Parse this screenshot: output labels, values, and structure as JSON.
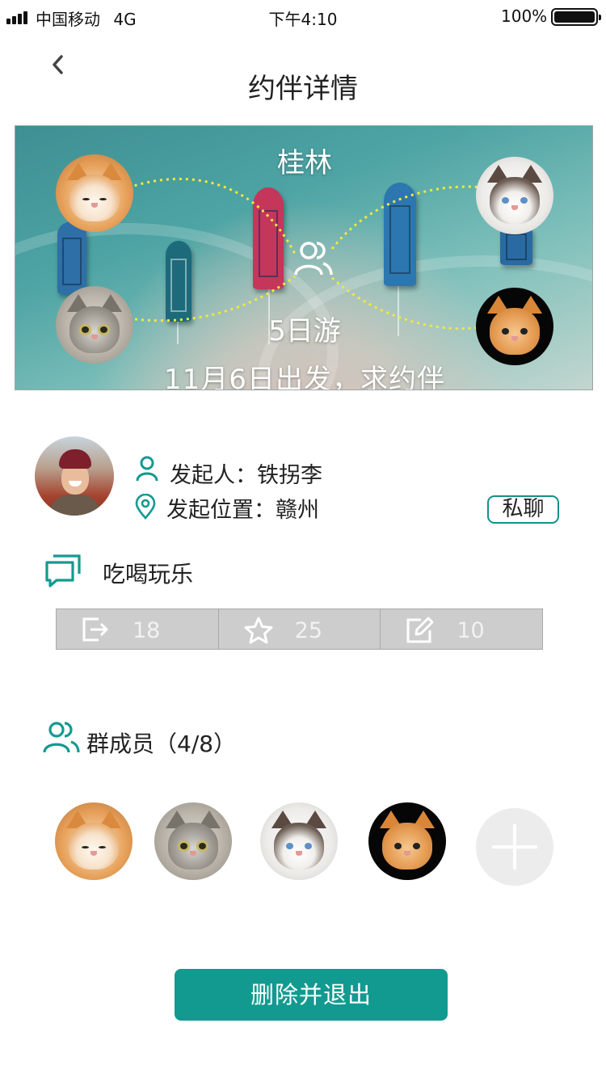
{
  "status_bar": {
    "carrier": "中国移动",
    "network": "4G",
    "time": "下午4:10",
    "battery": "100%"
  },
  "header": {
    "title": "约伴详情",
    "back_icon": "chevron-left-icon"
  },
  "banner": {
    "city": "桂林",
    "duration": "5日游",
    "subtitle": "11月6日出发，求约伴",
    "center_icon": "group-icon",
    "line_color": "#f2e93a"
  },
  "initiator": {
    "name_label": "发起人：",
    "name": "铁拐李",
    "location_label": "发起位置：",
    "location": "赣州",
    "chat_button": "私聊"
  },
  "category": {
    "icon": "chat-bubbles-icon",
    "label": "吃喝玩乐"
  },
  "stats": [
    {
      "icon": "share-icon",
      "value": "18"
    },
    {
      "icon": "star-icon",
      "value": "25"
    },
    {
      "icon": "edit-icon",
      "value": "10"
    }
  ],
  "members": {
    "icon": "group-icon",
    "title": "群成员（4/8）",
    "add_icon": "plus-icon"
  },
  "actions": {
    "delete_exit": "删除并退出"
  },
  "colors": {
    "accent": "#139a90",
    "stat_bg": "#cdcdcd"
  }
}
